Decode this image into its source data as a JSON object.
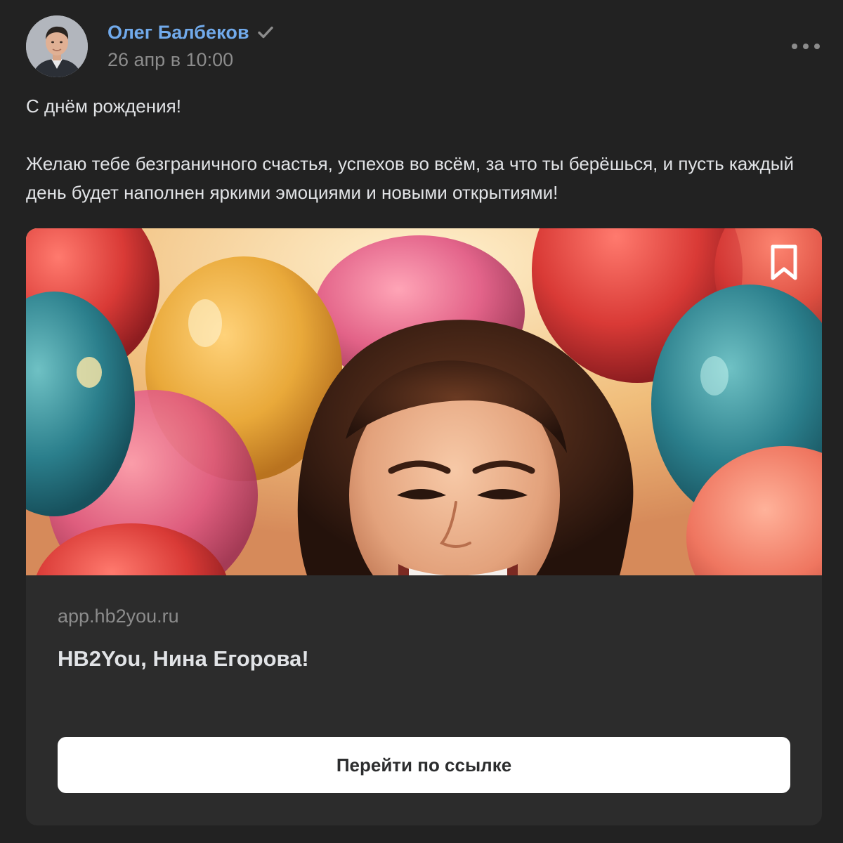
{
  "author": {
    "name": "Олег Балбеков",
    "date": "26 апр в 10:00"
  },
  "post": {
    "line1": "С днём рождения!",
    "line2": "Желаю тебе безграничного счастья, успехов во всём, за что ты берёшься, и пусть каждый день будет наполнен яркими эмоциями и новыми открытиями!"
  },
  "card": {
    "domain": "app.hb2you.ru",
    "title": "HB2You, Нина Егорова!",
    "button_label": "Перейти по ссылке"
  },
  "icons": {
    "verified": "check-icon",
    "more": "more-icon",
    "bookmark": "bookmark-icon"
  },
  "colors": {
    "background": "#222222",
    "card": "#2c2c2c",
    "accent": "#71aaeb",
    "secondary_text": "#8c8c8c",
    "primary_text": "#e1e3e6",
    "button": "#ffffff"
  }
}
